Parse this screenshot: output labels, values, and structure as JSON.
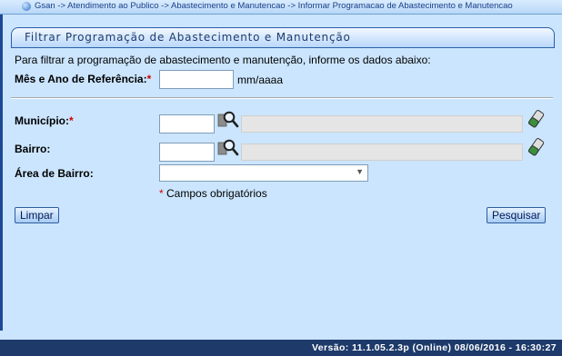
{
  "breadcrumb": {
    "text": "Gsan -> Atendimento ao Publico -> Abastecimento e Manutencao -> Informar Programacao de Abastecimento e Manutencao"
  },
  "form": {
    "title": "Filtrar Programação de Abastecimento e Manutenção",
    "instructions": "Para filtrar a programação de abastecimento e manutenção, informe os dados abaixo:",
    "mes_ano": {
      "label": "Mês e Ano de Referência:",
      "required_mark": "*",
      "value": "",
      "hint": "mm/aaaa"
    },
    "municipio": {
      "label": "Município:",
      "required_mark": "*",
      "code": "",
      "description": ""
    },
    "bairro": {
      "label": "Bairro:",
      "code": "",
      "description": ""
    },
    "area_bairro": {
      "label": "Área de Bairro:",
      "selected": ""
    },
    "required_note": {
      "mark": "*",
      "text": "Campos obrigatórios"
    },
    "buttons": {
      "clear": "Limpar",
      "search": "Pesquisar"
    }
  },
  "footer": {
    "version": "Versão: 11.1.05.2.3p (Online) 08/06/2016 - 16:30:27"
  },
  "colors": {
    "background": "#cbe5fe",
    "footer": "#1d3a6a",
    "required": "#d40000",
    "title_text": "#1e3c6e"
  },
  "icons": [
    "globe-icon",
    "search-icon",
    "eraser-icon",
    "dropdown-arrow-icon"
  ]
}
